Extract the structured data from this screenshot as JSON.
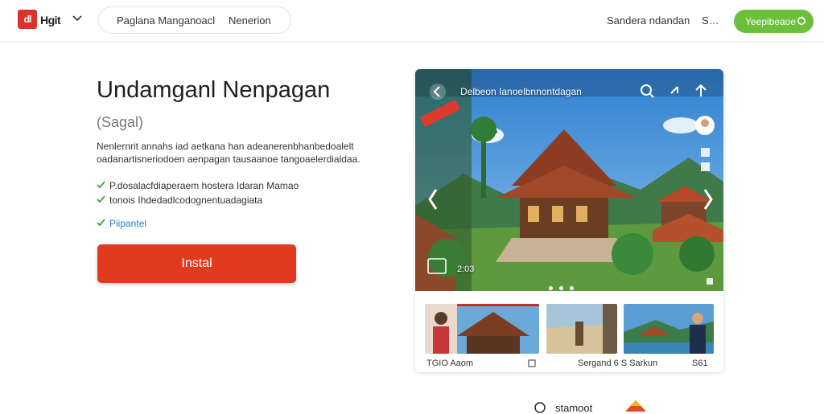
{
  "header": {
    "logo_text": "dl",
    "brand": "Hgit",
    "nav": [
      "Paglana Manganoacl",
      "Nenerion"
    ],
    "right_link": "Sandera ndandan",
    "right_short": "S…",
    "cta_label": "Yeepibeaoe"
  },
  "main": {
    "title": "Undamganl Nenpagan",
    "subtitle": "(Sagal)",
    "description": "Nenlernrit annahs iad aetkana han adeanerenbhanbedoalelt oadanartisneriodoen aenpagan tausaanoe tangoaelerdialdaa.",
    "checks": [
      "P.dosalacfdiaperaem hostera Idaran Mamao",
      "tonois Ihdedadlcodognentuadagiata"
    ],
    "check_link": "Piipantel",
    "install_label": "Instal"
  },
  "card": {
    "app_label": "Delbeon Ianoelbnnontdagan",
    "counter": "2:03",
    "thumbnails": [
      {
        "label": "TGIO Aaom"
      },
      {
        "label": "Sergand 6 S Sarkun"
      }
    ],
    "thumb_right_count": "S61"
  },
  "footer": {
    "text": "stamoot"
  },
  "colors": {
    "brand_red": "#d9332b",
    "install_red": "#e03a1f",
    "cta_green": "#6bbf3a",
    "check_green": "#3aa14a",
    "link_blue": "#1f7fc4"
  }
}
